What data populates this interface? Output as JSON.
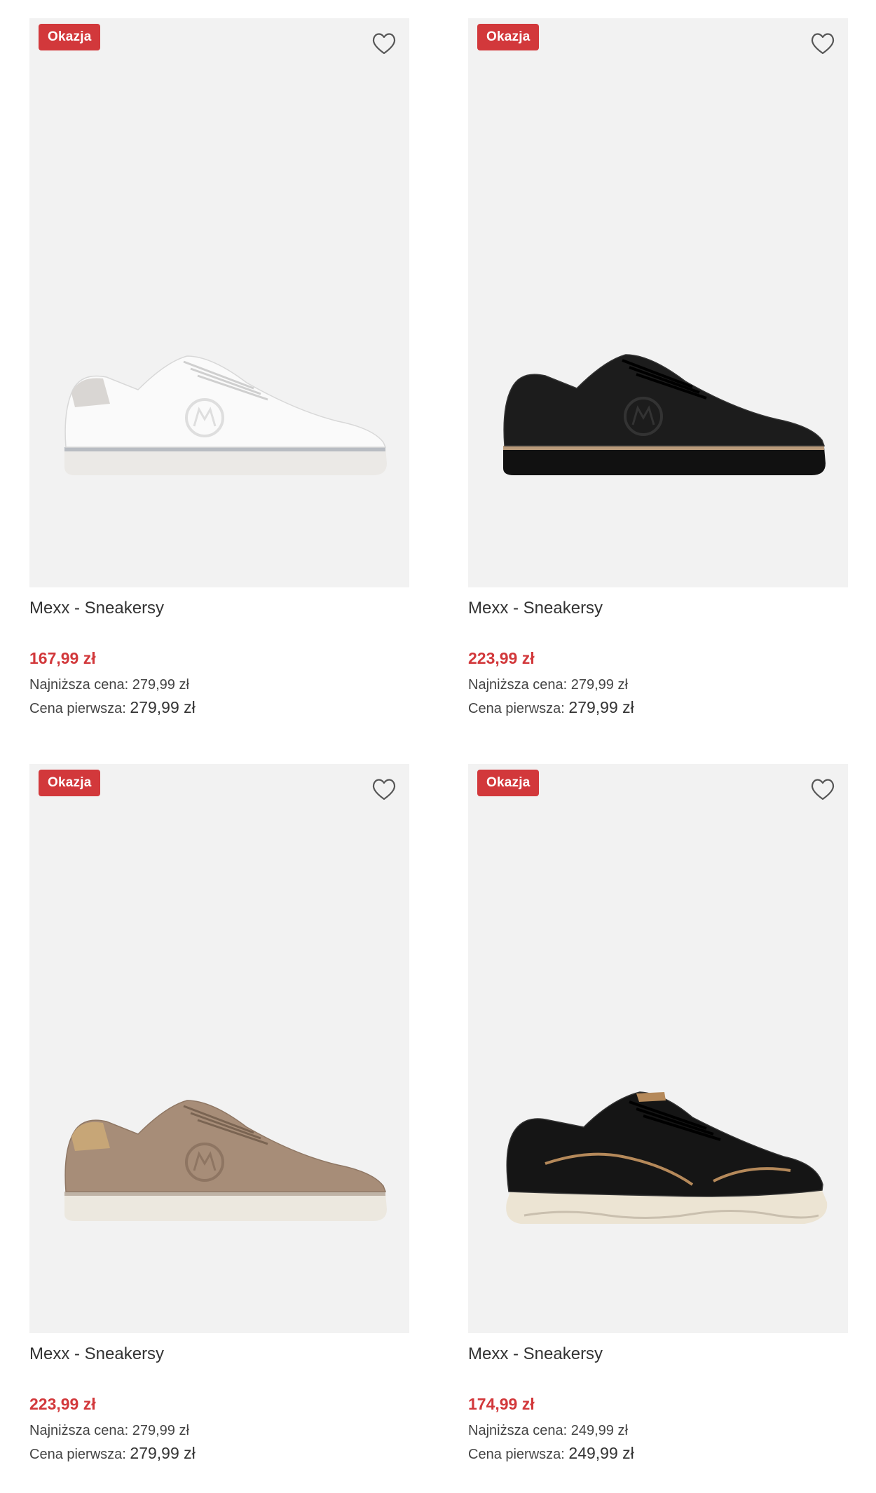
{
  "products": [
    {
      "badge": "Okazja",
      "title": "Mexx - Sneakersy",
      "price": "167,99 zł",
      "lowest_label": "Najniższa cena:",
      "lowest_value": "279,99 zł",
      "first_label": "Cena pierwsza:",
      "first_value": "279,99 zł",
      "image": "white-sneaker"
    },
    {
      "badge": "Okazja",
      "title": "Mexx - Sneakersy",
      "price": "223,99 zł",
      "lowest_label": "Najniższa cena:",
      "lowest_value": "279,99 zł",
      "first_label": "Cena pierwsza:",
      "first_value": "279,99 zł",
      "image": "black-sneaker"
    },
    {
      "badge": "Okazja",
      "title": "Mexx - Sneakersy",
      "price": "223,99 zł",
      "lowest_label": "Najniższa cena:",
      "lowest_value": "279,99 zł",
      "first_label": "Cena pierwsza:",
      "first_value": "279,99 zł",
      "image": "beige-sneaker"
    },
    {
      "badge": "Okazja",
      "title": "Mexx - Sneakersy",
      "price": "174,99 zł",
      "lowest_label": "Najniższa cena:",
      "lowest_value": "249,99 zł",
      "first_label": "Cena pierwsza:",
      "first_value": "249,99 zł",
      "image": "black-running-sneaker"
    }
  ],
  "colors": {
    "badge": "#d2383b",
    "price": "#d2383b",
    "image_bg": "#f2f2f2"
  }
}
